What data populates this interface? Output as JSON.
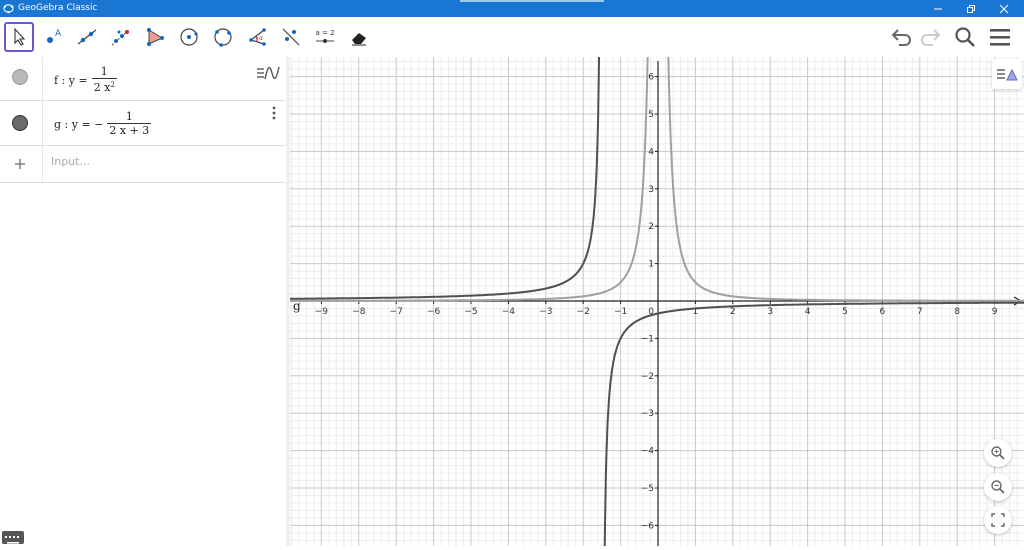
{
  "window": {
    "title": "GeoGebra Classic"
  },
  "toolbar": {
    "tools": [
      "move-tool",
      "point-tool",
      "line-tool",
      "perpendicular-line-tool",
      "polygon-tool",
      "circle-center-point-tool",
      "circle-three-points-tool",
      "angle-tool",
      "reflect-tool",
      "slider-tool",
      "delete-tool"
    ],
    "slider_label": "a = 2"
  },
  "algebra": {
    "rows": [
      {
        "color": "#b0b0b0",
        "name": "f",
        "lhs": "f : y =",
        "num": "1",
        "den": "2 x",
        "den_sup": "2"
      },
      {
        "color": "#616161",
        "name": "g",
        "lhs": "g : y = −",
        "num": "1",
        "den": "2 x + 3",
        "den_sup": ""
      }
    ],
    "input_placeholder": "Input..."
  },
  "graph": {
    "x_ticks": [
      -9,
      -8,
      -7,
      -6,
      -5,
      -4,
      -3,
      -2,
      -1,
      1,
      2,
      3,
      4,
      5,
      6,
      7,
      8,
      9
    ],
    "y_ticks": [
      -6,
      -5,
      -4,
      -3,
      -2,
      -1,
      1,
      2,
      3,
      4,
      5,
      6
    ],
    "origin_label": "0",
    "curve_label": "g",
    "colors": {
      "f": "#a0a0a0",
      "g": "#505050",
      "axis": "#222222",
      "grid_major": "#c8c8c8",
      "grid_minor": "#ececec"
    },
    "functions": {
      "f": "1/(2x^2)",
      "g": "-1/(2x+3)"
    }
  }
}
